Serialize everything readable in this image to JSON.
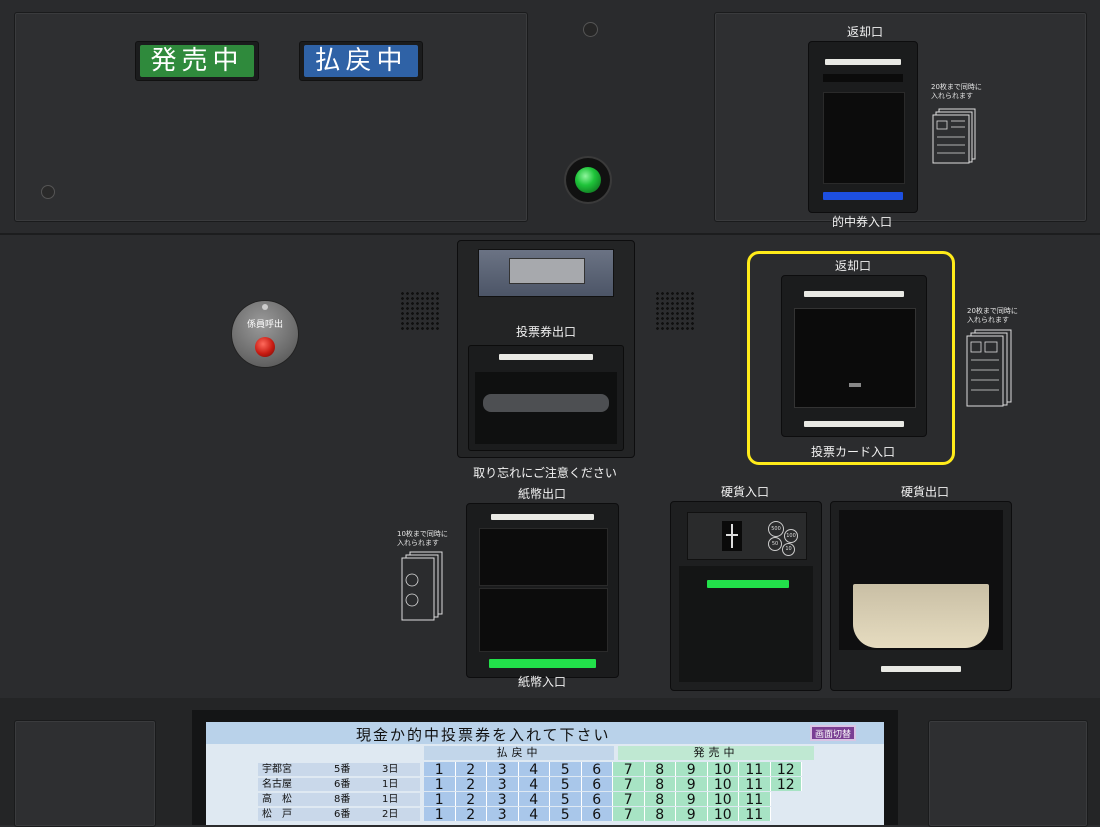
{
  "status": {
    "selling": {
      "label": "発売中",
      "color": "#2f8a3c"
    },
    "refunding": {
      "label": "払戻中",
      "color": "#2f62a6"
    }
  },
  "top_slot": {
    "return_label": "返却口",
    "entry_label": "的中券入口",
    "note": [
      "20枚まで同時に",
      "入れられます"
    ],
    "indicator_color": "#1d4fe0"
  },
  "call_button": {
    "label": "係員呼出",
    "color": "#c71b12"
  },
  "ticket_out": {
    "label": "投票券出口",
    "caution": "取り忘れにご注意ください"
  },
  "card_slot": {
    "return_label": "返却口",
    "entry_label": "投票カード入口",
    "note": [
      "20枚まで同時に",
      "入れられます"
    ],
    "highlight_color": "#ffeb1a"
  },
  "bills": {
    "out_label": "紙幣出口",
    "in_label": "紙幣入口",
    "note": [
      "10枚まで同時に",
      "入れられます"
    ],
    "indicator_color": "#22e04a"
  },
  "coins": {
    "in_label": "硬貨入口",
    "out_label": "硬貨出口",
    "denominations": [
      "500",
      "100",
      "50",
      "10"
    ],
    "indicator_color": "#22e04a"
  },
  "lamp_color": "#1fc43a",
  "screen": {
    "message": "現金か的中投票券を入れて下さい",
    "switch_button": "画面切替",
    "refund_header": "払戻中",
    "sale_header": "発売中",
    "races": [
      {
        "venue": "宇都宮",
        "number": "5番",
        "day": "3日",
        "cells": [
          "1",
          "2",
          "3",
          "4",
          "5",
          "6",
          "7",
          "8",
          "9",
          "10",
          "11",
          "12"
        ]
      },
      {
        "venue": "名古屋",
        "number": "6番",
        "day": "1日",
        "cells": [
          "1",
          "2",
          "3",
          "4",
          "5",
          "6",
          "7",
          "8",
          "9",
          "10",
          "11",
          "12"
        ]
      },
      {
        "venue": "高　松",
        "number": "8番",
        "day": "1日",
        "cells": [
          "1",
          "2",
          "3",
          "4",
          "5",
          "6",
          "7",
          "8",
          "9",
          "10",
          "11"
        ]
      },
      {
        "venue": "松　戸",
        "number": "6番",
        "day": "2日",
        "cells": [
          "1",
          "2",
          "3",
          "4",
          "5",
          "6",
          "7",
          "8",
          "9",
          "10",
          "11"
        ]
      }
    ]
  }
}
